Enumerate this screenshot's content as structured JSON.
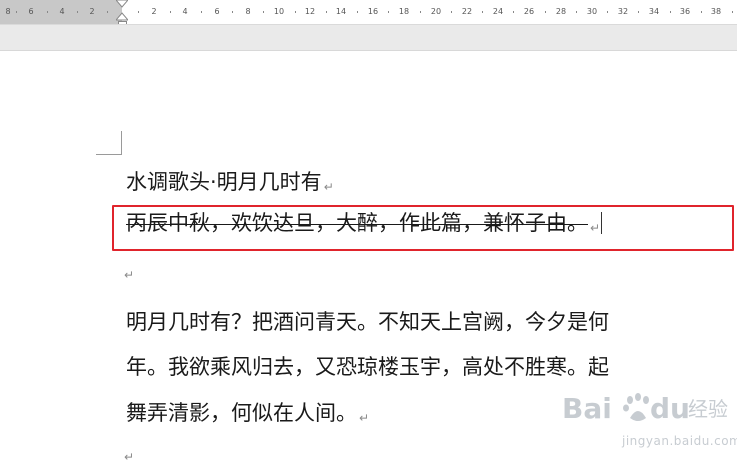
{
  "ruler": {
    "ticks": [
      "8",
      "6",
      "4",
      "2",
      "2",
      "4",
      "6",
      "8",
      "10",
      "12",
      "14",
      "16",
      "18",
      "20",
      "22",
      "24",
      "26",
      "28",
      "30",
      "32",
      "34",
      "36",
      "38"
    ]
  },
  "document": {
    "title": "水调歌头·明月几时有",
    "subtitle": "丙辰中秋，欢饮达旦，大醉，作此篇，兼怀子由。",
    "paragraph_mark": "↵",
    "body_lines": [
      "明月几时有？把酒问青天。不知天上宫阙，今夕是何",
      "年。我欲乘风归去，又恐琼楼玉宇，高处不胜寒。起",
      "舞弄清影，何似在人间。"
    ]
  },
  "colors": {
    "highlight_border": "#e0242c",
    "ruler_margin": "#c8c8c8",
    "band": "#eaeaea"
  },
  "watermark": {
    "logo": "Bai du 经验",
    "url": "jingyan.baidu.com"
  }
}
